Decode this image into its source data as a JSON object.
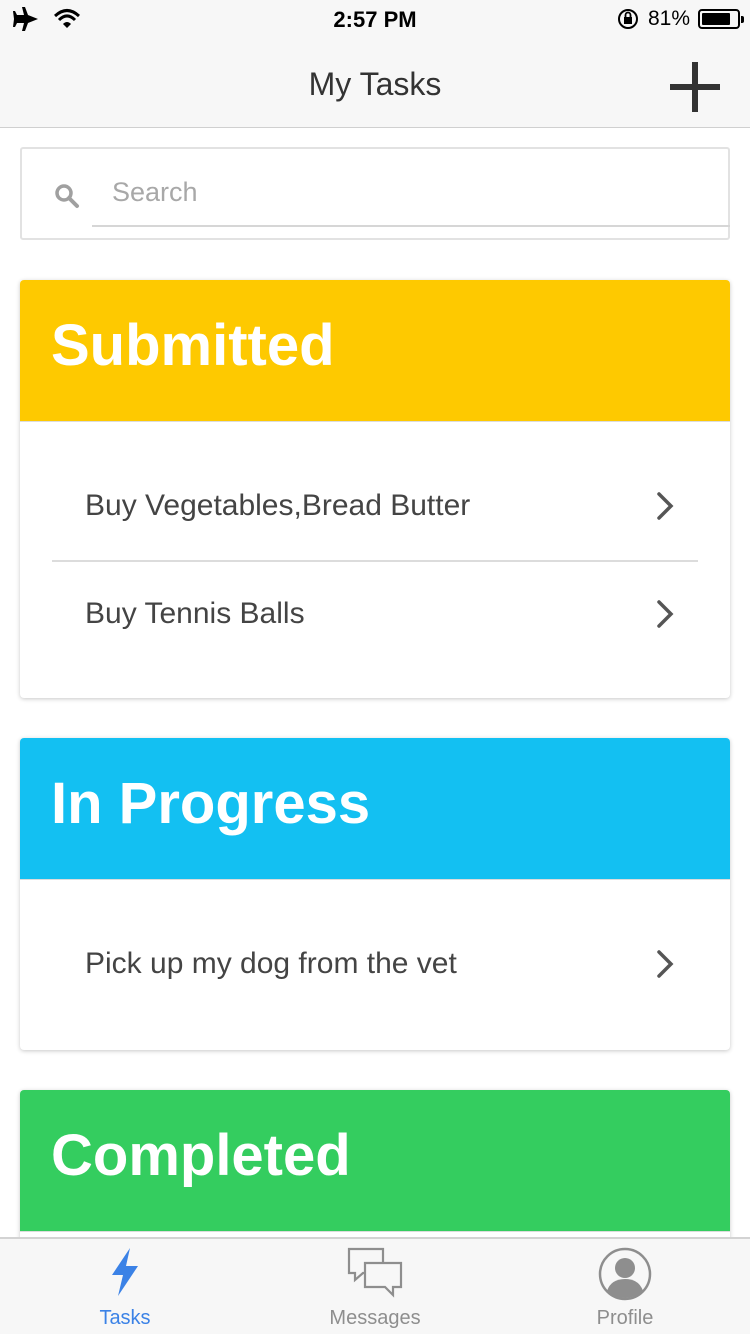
{
  "status_bar": {
    "time": "2:57 PM",
    "battery": "81%",
    "battery_level": 0.81
  },
  "nav": {
    "title": "My Tasks",
    "add_icon": "plus-icon"
  },
  "search": {
    "placeholder": "Search",
    "value": ""
  },
  "sections": [
    {
      "title": "Submitted",
      "color": "#FEC900",
      "tasks": [
        "Buy Vegetables,Bread Butter",
        "Buy Tennis Balls"
      ]
    },
    {
      "title": "In Progress",
      "color": "#13C0F2",
      "tasks": [
        "Pick up my dog from the vet"
      ]
    },
    {
      "title": "Completed",
      "color": "#34CD5F",
      "tasks": []
    }
  ],
  "tabs": [
    {
      "label": "Tasks",
      "icon": "lightning-icon",
      "active": true
    },
    {
      "label": "Messages",
      "icon": "chat-bubbles-icon",
      "active": false
    },
    {
      "label": "Profile",
      "icon": "user-avatar-icon",
      "active": false
    }
  ],
  "colors": {
    "accent": "#3B82E6",
    "text": "#444444"
  }
}
